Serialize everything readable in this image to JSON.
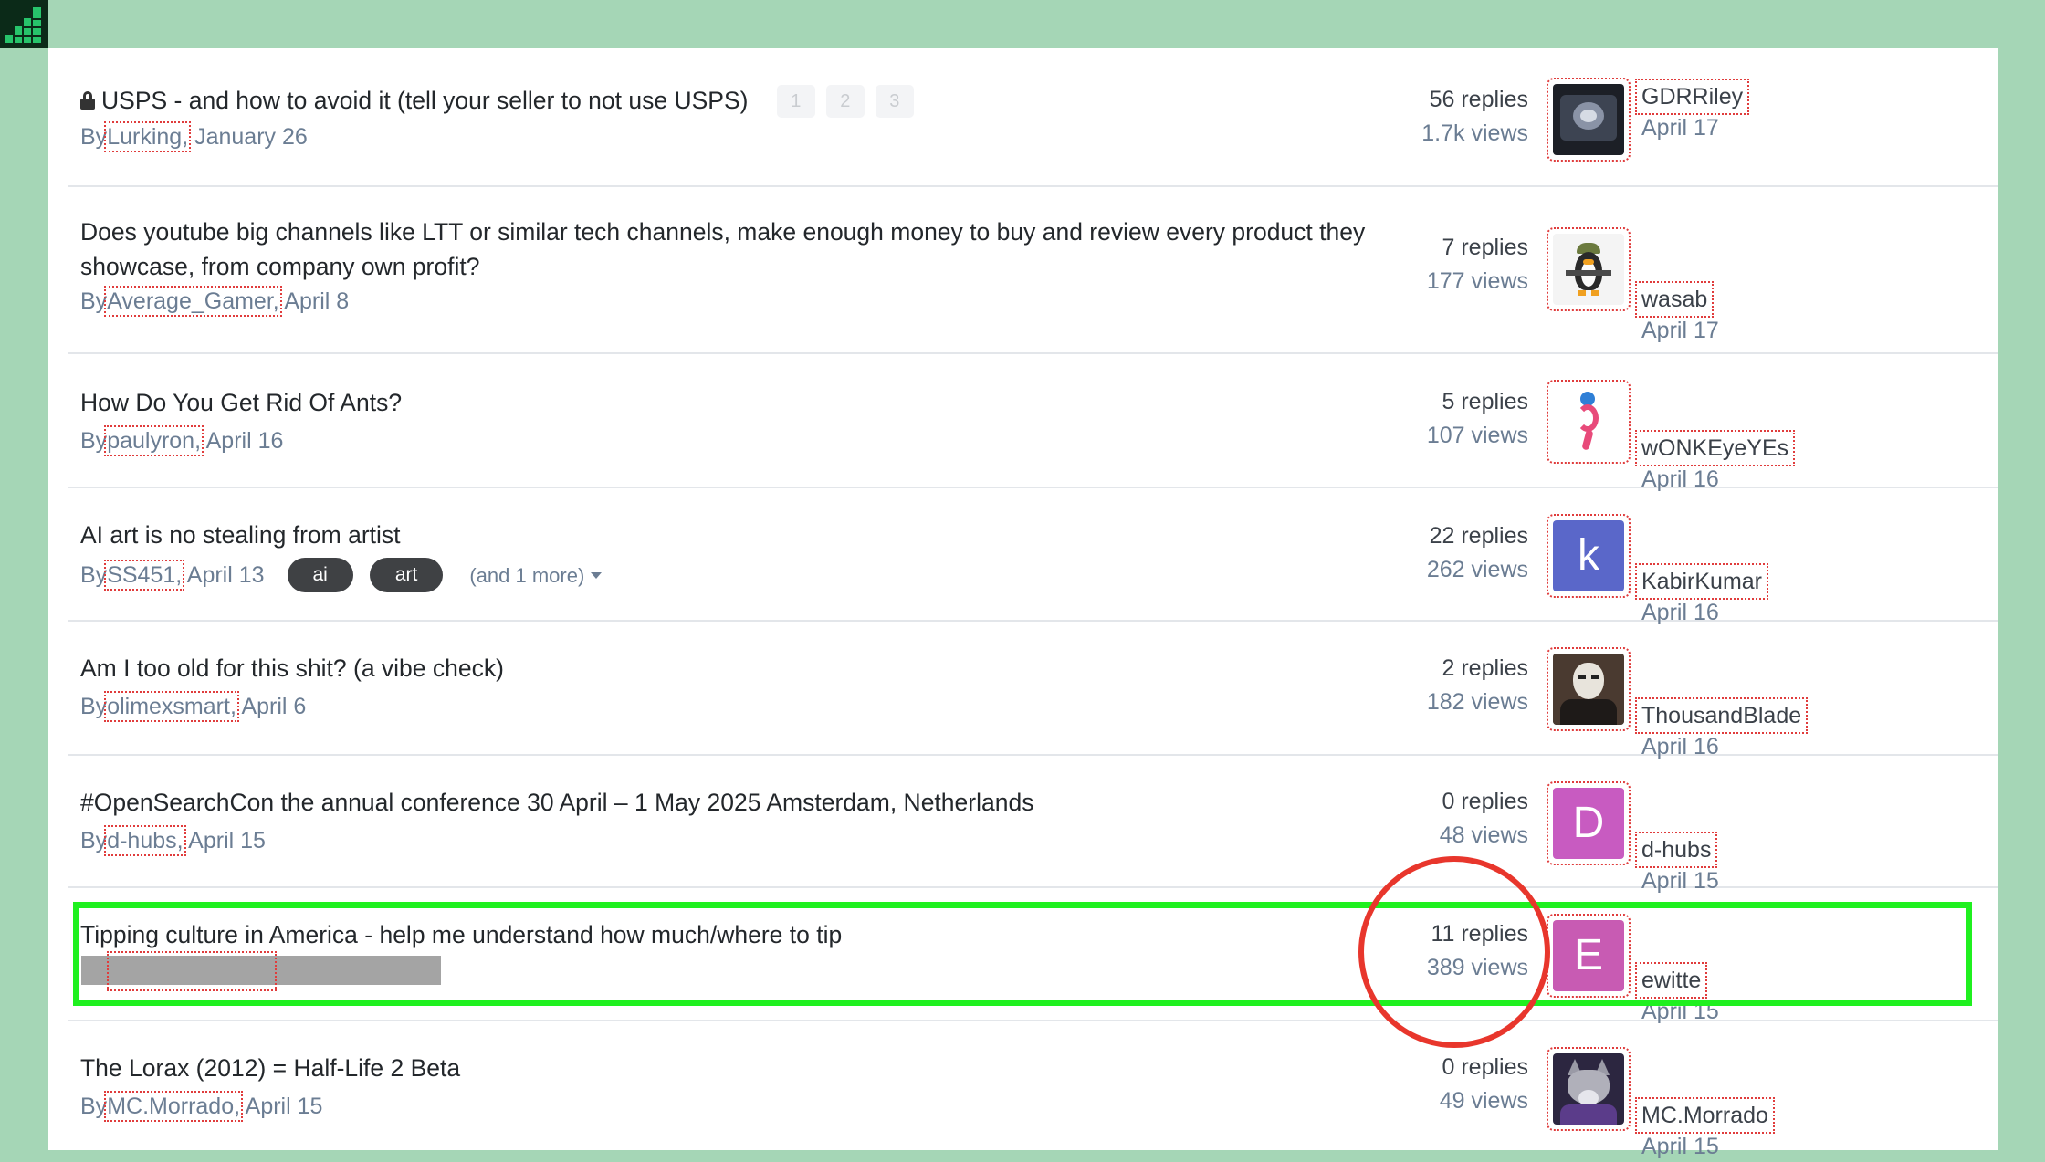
{
  "colors": {
    "page_bg": "#a5d6b6",
    "highlight_box": "#1ff01f",
    "highlight_circle": "#e8362c",
    "tag_bg": "#3f4144"
  },
  "topics": [
    {
      "title": "USPS - and how to avoid it (tell your seller to not use USPS)",
      "locked": true,
      "pages": [
        "1",
        "2",
        "3"
      ],
      "by": "By",
      "author": "Lurking",
      "sep": ",",
      "date": "January 26",
      "replies": "56 replies",
      "views": "1.7k views",
      "last_poster": "GDRRiley",
      "last_date": "April 17",
      "avatar": "dark-photo-avatar"
    },
    {
      "title": "Does youtube big channels like LTT or similar tech channels, make enough money to buy and review every product they showcase, from company own profit?",
      "by": "By",
      "author": "Average_Gamer",
      "sep": ",",
      "date": "April 8",
      "replies": "7 replies",
      "views": "177 views",
      "last_poster": "wasab",
      "last_date": "April 17",
      "avatar": "penguin-soldier-avatar"
    },
    {
      "title": "How Do You Get Rid Of Ants?",
      "by": "By",
      "author": "paulyron",
      "sep": ",",
      "date": "April 16",
      "replies": "5 replies",
      "views": "107 views",
      "last_poster": "wONKEyeYEs",
      "last_date": "April 16",
      "avatar": "figure-avatar"
    },
    {
      "title": "AI art is no stealing from artist",
      "by": "By",
      "author": "SS451",
      "sep": ",",
      "date": "April 13",
      "tags": [
        "ai",
        "art"
      ],
      "more": "(and 1 more)",
      "replies": "22 replies",
      "views": "262 views",
      "last_poster": "KabirKumar",
      "last_date": "April 16",
      "avatar_letter": "k",
      "avatar_color": "#5a67c9"
    },
    {
      "title": "Am I too old for this shit? (a vibe check)",
      "by": "By",
      "author": "olimexsmart",
      "sep": ",",
      "date": "April 6",
      "replies": "2 replies",
      "views": "182 views",
      "last_poster": "ThousandBlade",
      "last_date": "April 16",
      "avatar": "masked-person-avatar"
    },
    {
      "title": "#OpenSearchCon the annual conference 30 April – 1 May 2025 Amsterdam, Netherlands",
      "by": "By",
      "author": "d-hubs",
      "sep": ",",
      "date": "April 15",
      "replies": "0 replies",
      "views": "48 views",
      "last_poster": "d-hubs",
      "last_date": "April 15",
      "avatar_letter": "D",
      "avatar_color": "#c85bc1"
    },
    {
      "title": "Tipping culture in America - help me understand how much/where to tip",
      "author_redacted": true,
      "replies": "11 replies",
      "views": "389 views",
      "last_poster": "ewitte",
      "last_date": "April 15",
      "avatar_letter": "E",
      "avatar_color": "#c85bb3"
    },
    {
      "title": "The Lorax (2012) = Half-Life 2 Beta",
      "by": "By",
      "author": "MC.Morrado",
      "sep": ",",
      "date": "April 15",
      "replies": "0 replies",
      "views": "49 views",
      "last_poster": "MC.Morrado",
      "last_date": "April 15",
      "avatar": "wolf-avatar"
    }
  ]
}
